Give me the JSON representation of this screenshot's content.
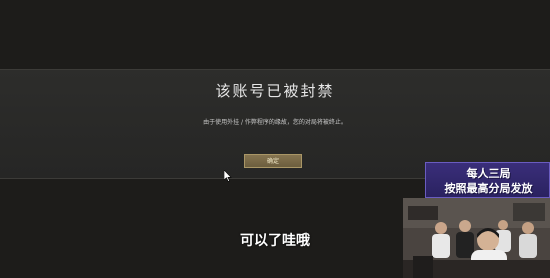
{
  "dialog": {
    "title": "该账号已被封禁",
    "message": "由于使用外挂 / 作弊程序的缘故，您的对局将被终止。",
    "confirm_label": "确定"
  },
  "stream_overlay": {
    "subtitle": "可以了哇哦",
    "promo_line1": "每人三局",
    "promo_line2": "按照最高分局发放"
  },
  "colors": {
    "dialog_bg": "#2a2a28",
    "button_gold": "#7a6a48",
    "promo_purple": "#3a2e7a"
  }
}
